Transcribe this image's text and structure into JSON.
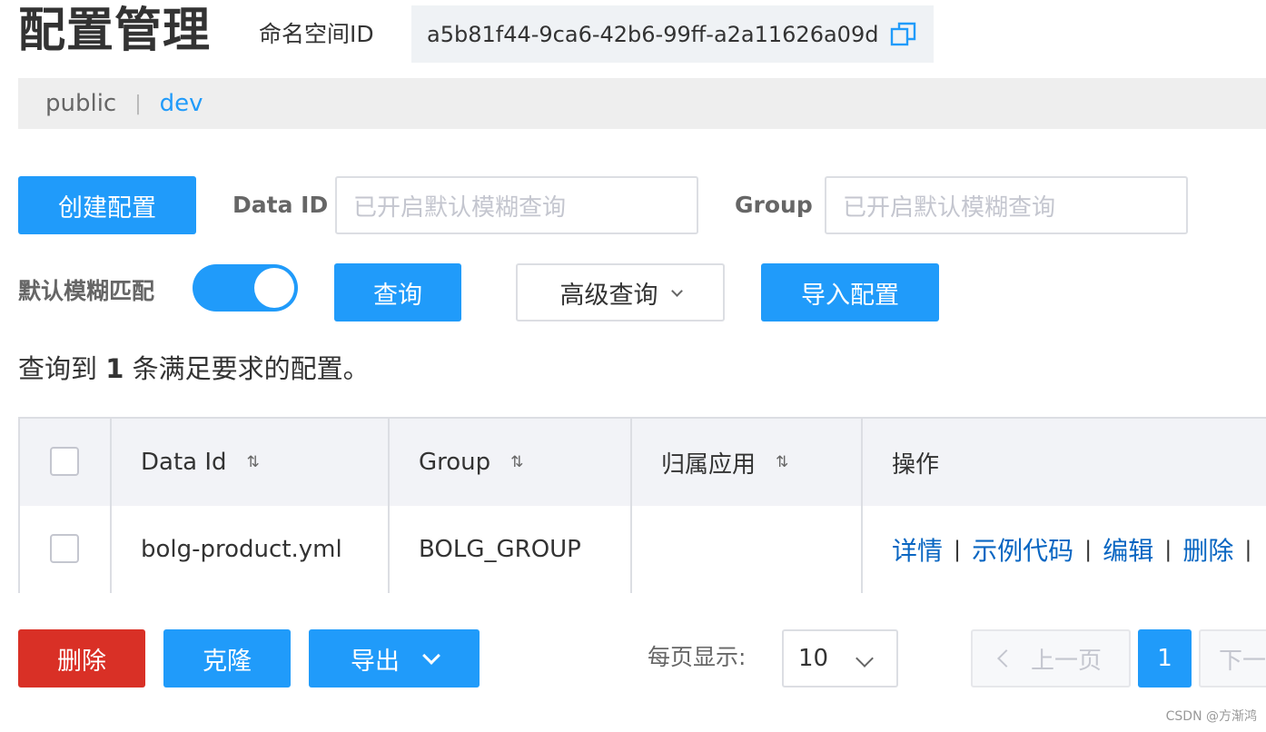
{
  "header": {
    "title": "配置管理",
    "namespace_label": "命名空间ID",
    "namespace_id": "a5b81f44-9ca6-42b6-99ff-a2a11626a09d"
  },
  "namespaces": {
    "items": [
      "public",
      "dev"
    ],
    "separator": "|",
    "active": "dev"
  },
  "toolbar": {
    "create_label": "创建配置",
    "data_id_label": "Data ID",
    "data_id_placeholder": "已开启默认模糊查询",
    "group_label": "Group",
    "group_placeholder": "已开启默认模糊查询",
    "fuzzy_label": "默认模糊匹配",
    "fuzzy_enabled": true,
    "query_label": "查询",
    "advanced_label": "高级查询",
    "import_label": "导入配置"
  },
  "summary": {
    "prefix": "查询到",
    "count": "1",
    "suffix": "条满足要求的配置。"
  },
  "table": {
    "columns": [
      "Data Id",
      "Group",
      "归属应用",
      "操作"
    ],
    "rows": [
      {
        "data_id": "bolg-product.yml",
        "group": "BOLG_GROUP",
        "app": "",
        "actions": [
          "详情",
          "示例代码",
          "编辑",
          "删除"
        ],
        "action_separator": "|"
      }
    ]
  },
  "footer": {
    "delete_label": "删除",
    "clone_label": "克隆",
    "export_label": "导出",
    "page_size_label": "每页显示:",
    "page_size": "10",
    "prev_label": "上一页",
    "current_page": "1",
    "next_label": "下一页"
  },
  "watermark": "CSDN @方渐鸿",
  "colors": {
    "primary": "#209bfa",
    "danger": "#d93026",
    "link": "#0966c2"
  }
}
